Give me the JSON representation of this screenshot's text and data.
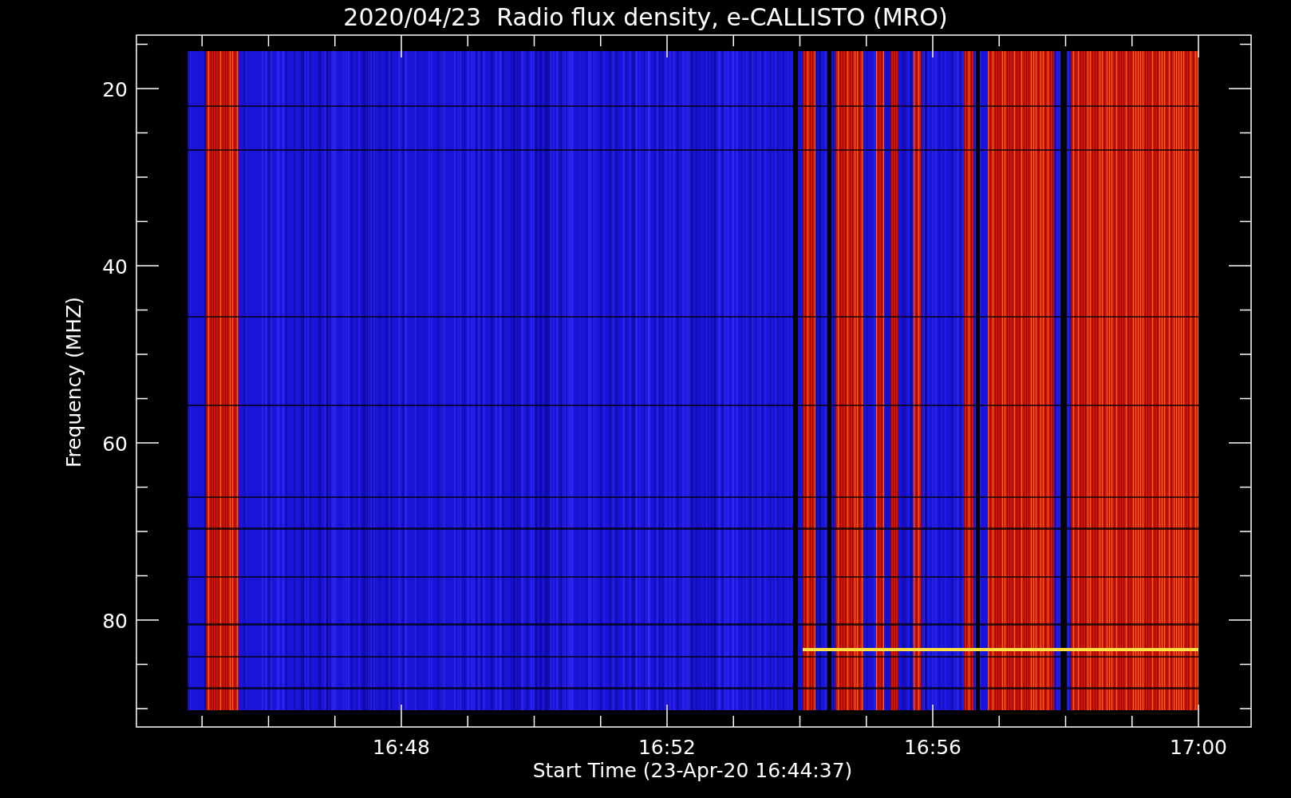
{
  "title": "2020/04/23  Radio flux density, e-CALLISTO (MRO)",
  "ylabel": "Frequency (MHZ)",
  "xlabel": "Start Time (23-Apr-20 16:44:37)",
  "yticks": [
    "20",
    "40",
    "60",
    "80"
  ],
  "xticks": [
    "16:48",
    "16:52",
    "16:56",
    "17:00"
  ]
}
